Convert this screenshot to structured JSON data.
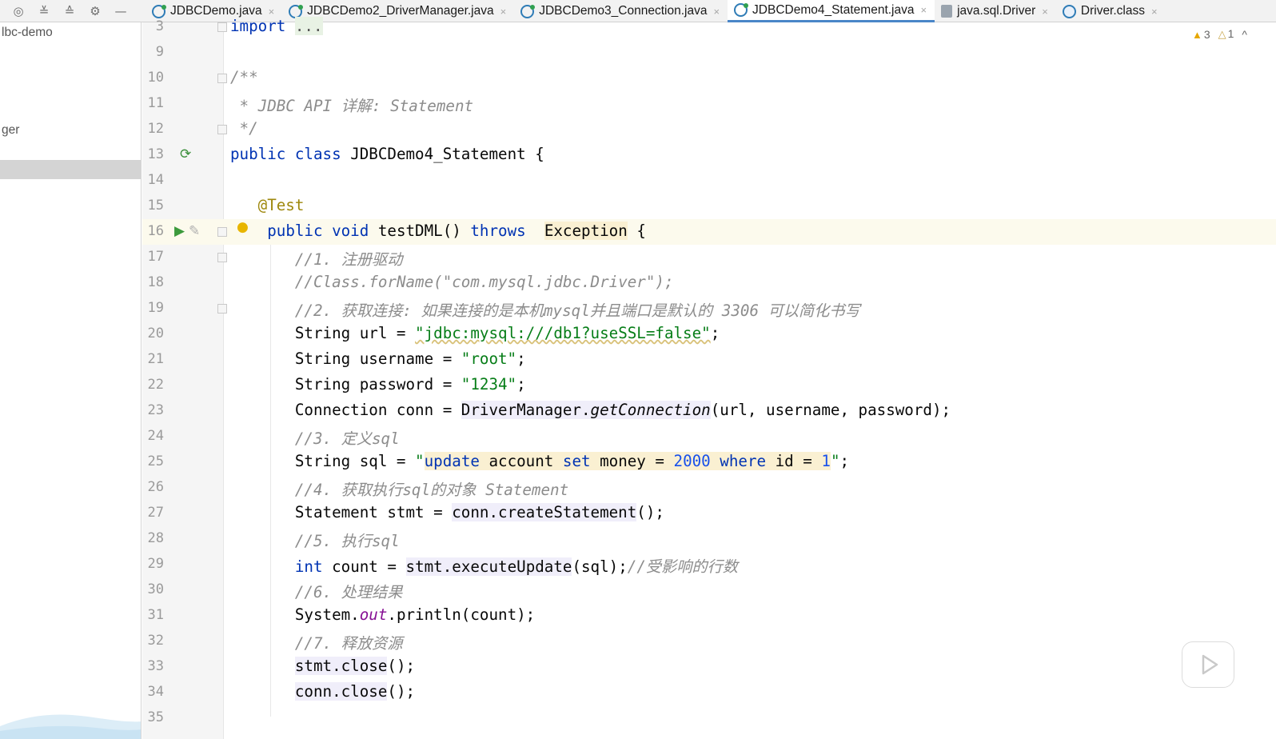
{
  "toolbar": {
    "icons": [
      "sync-icon",
      "expand-all-icon",
      "collapse-all-icon",
      "gear-icon",
      "minimize-icon"
    ]
  },
  "tabs": [
    {
      "label": "JDBCDemo.java",
      "close": "×",
      "icon": "java-class-icon",
      "active": false
    },
    {
      "label": "JDBCDemo2_DriverManager.java",
      "close": "×",
      "icon": "java-class-icon",
      "active": false
    },
    {
      "label": "JDBCDemo3_Connection.java",
      "close": "×",
      "icon": "java-class-icon",
      "active": false
    },
    {
      "label": "JDBCDemo4_Statement.java",
      "close": "×",
      "icon": "java-class-icon",
      "active": true
    },
    {
      "label": "java.sql.Driver",
      "close": "×",
      "icon": "interface-icon",
      "active": false
    },
    {
      "label": "Driver.class",
      "close": "×",
      "icon": "class-file-icon",
      "active": false
    }
  ],
  "sidebar": {
    "project_label": "lbc-demo",
    "item_label": "ger"
  },
  "inspections": {
    "warnings": "3",
    "weak_warnings": "1",
    "collapse": "^"
  },
  "colors": {
    "keyword": "#0033b3",
    "string": "#067d17",
    "comment": "#8c8c8c",
    "annotation": "#9e880d",
    "active_tab_underline": "#4a86c8"
  },
  "code": {
    "lines": [
      {
        "n": "3",
        "tokens": [
          {
            "t": "import ",
            "c": "kw"
          },
          {
            "t": "...",
            "c": "import-fold"
          }
        ]
      },
      {
        "n": "9",
        "tokens": []
      },
      {
        "n": "10",
        "tokens": [
          {
            "t": "/**",
            "c": "doc"
          }
        ]
      },
      {
        "n": "11",
        "tokens": [
          {
            "t": " * JDBC API 详解: Statement",
            "c": "doc"
          }
        ]
      },
      {
        "n": "12",
        "tokens": [
          {
            "t": " */",
            "c": "doc"
          }
        ]
      },
      {
        "n": "13",
        "tokens": [
          {
            "t": "public class ",
            "c": "kw"
          },
          {
            "t": "JDBCDemo4_Statement {",
            "c": ""
          }
        ]
      },
      {
        "n": "14",
        "tokens": []
      },
      {
        "n": "15",
        "tokens": [
          {
            "t": "   ",
            "c": ""
          },
          {
            "t": "@Test",
            "c": "ann"
          }
        ]
      },
      {
        "n": "16",
        "tokens": [
          {
            "t": "    ",
            "c": ""
          },
          {
            "t": "public void ",
            "c": "kw"
          },
          {
            "t": "testDML",
            "c": ""
          },
          {
            "t": "() ",
            "c": ""
          },
          {
            "t": "throws ",
            "c": "kw"
          },
          {
            "t": " ",
            "c": ""
          },
          {
            "t": "Exception",
            "c": "sqlhl"
          },
          {
            "t": " {",
            "c": ""
          }
        ]
      },
      {
        "n": "17",
        "tokens": [
          {
            "t": "       ",
            "c": ""
          },
          {
            "t": "//1. 注册驱动",
            "c": "cm"
          }
        ]
      },
      {
        "n": "18",
        "tokens": [
          {
            "t": "       ",
            "c": ""
          },
          {
            "t": "//Class.forName(\"com.mysql.jdbc.Driver\");",
            "c": "cm"
          }
        ]
      },
      {
        "n": "19",
        "tokens": [
          {
            "t": "       ",
            "c": ""
          },
          {
            "t": "//2. 获取连接: 如果连接的是本机mysql并且端口是默认的 3306 可以简化书写",
            "c": "cm"
          }
        ]
      },
      {
        "n": "20",
        "tokens": [
          {
            "t": "       String url = ",
            "c": ""
          },
          {
            "t": "\"jdbc:mysql:///db1?useSSL=false\"",
            "c": "str"
          },
          {
            "t": ";",
            "c": ""
          }
        ]
      },
      {
        "n": "21",
        "tokens": [
          {
            "t": "       String username = ",
            "c": ""
          },
          {
            "t": "\"root\"",
            "c": "str"
          },
          {
            "t": ";",
            "c": ""
          }
        ]
      },
      {
        "n": "22",
        "tokens": [
          {
            "t": "       String password = ",
            "c": ""
          },
          {
            "t": "\"1234\"",
            "c": "str"
          },
          {
            "t": ";",
            "c": ""
          }
        ]
      },
      {
        "n": "23",
        "tokens": [
          {
            "t": "       Connection conn = ",
            "c": ""
          },
          {
            "t": "DriverManager.",
            "c": "hl"
          },
          {
            "t": "getConnection",
            "c": "hl static"
          },
          {
            "t": "(url, username, password);",
            "c": ""
          }
        ]
      },
      {
        "n": "24",
        "tokens": [
          {
            "t": "       ",
            "c": ""
          },
          {
            "t": "//3. 定义sql",
            "c": "cm"
          }
        ]
      },
      {
        "n": "25",
        "tokens": [
          {
            "t": "       String sql = ",
            "c": ""
          },
          {
            "t": "\"",
            "c": "str"
          },
          {
            "t": "update",
            "c": "sqlhl sqlkw"
          },
          {
            "t": " account ",
            "c": "sqlhl"
          },
          {
            "t": "set",
            "c": "sqlhl sqlkw"
          },
          {
            "t": " money = ",
            "c": "sqlhl"
          },
          {
            "t": "2000",
            "c": "sqlhl sqlnum"
          },
          {
            "t": " ",
            "c": "sqlhl"
          },
          {
            "t": "where",
            "c": "sqlhl sqlkw"
          },
          {
            "t": " id = ",
            "c": "sqlhl"
          },
          {
            "t": "1",
            "c": "sqlhl sqlnum"
          },
          {
            "t": "\"",
            "c": "str"
          },
          {
            "t": ";",
            "c": ""
          }
        ]
      },
      {
        "n": "26",
        "tokens": [
          {
            "t": "       ",
            "c": ""
          },
          {
            "t": "//4. 获取执行sql的对象 Statement",
            "c": "cm"
          }
        ]
      },
      {
        "n": "27",
        "tokens": [
          {
            "t": "       Statement stmt = ",
            "c": ""
          },
          {
            "t": "conn.createStatement",
            "c": "hl"
          },
          {
            "t": "();",
            "c": ""
          }
        ]
      },
      {
        "n": "28",
        "tokens": [
          {
            "t": "       ",
            "c": ""
          },
          {
            "t": "//5. 执行sql",
            "c": "cm"
          }
        ]
      },
      {
        "n": "29",
        "tokens": [
          {
            "t": "       ",
            "c": ""
          },
          {
            "t": "int ",
            "c": "kw"
          },
          {
            "t": "count = ",
            "c": ""
          },
          {
            "t": "stmt.executeUpdate",
            "c": "hl"
          },
          {
            "t": "(sql);",
            "c": ""
          },
          {
            "t": "//受影响的行数",
            "c": "cm"
          }
        ]
      },
      {
        "n": "30",
        "tokens": [
          {
            "t": "       ",
            "c": ""
          },
          {
            "t": "//6. 处理结果",
            "c": "cm"
          }
        ]
      },
      {
        "n": "31",
        "tokens": [
          {
            "t": "       System.",
            "c": ""
          },
          {
            "t": "out",
            "c": "fld"
          },
          {
            "t": ".println(count);",
            "c": ""
          }
        ]
      },
      {
        "n": "32",
        "tokens": [
          {
            "t": "       ",
            "c": ""
          },
          {
            "t": "//7. 释放资源",
            "c": "cm"
          }
        ]
      },
      {
        "n": "33",
        "tokens": [
          {
            "t": "       ",
            "c": ""
          },
          {
            "t": "stmt.close",
            "c": "hl"
          },
          {
            "t": "();",
            "c": ""
          }
        ]
      },
      {
        "n": "34",
        "tokens": [
          {
            "t": "       ",
            "c": ""
          },
          {
            "t": "conn.close",
            "c": "hl"
          },
          {
            "t": "();",
            "c": ""
          }
        ]
      },
      {
        "n": "35",
        "tokens": []
      }
    ]
  }
}
